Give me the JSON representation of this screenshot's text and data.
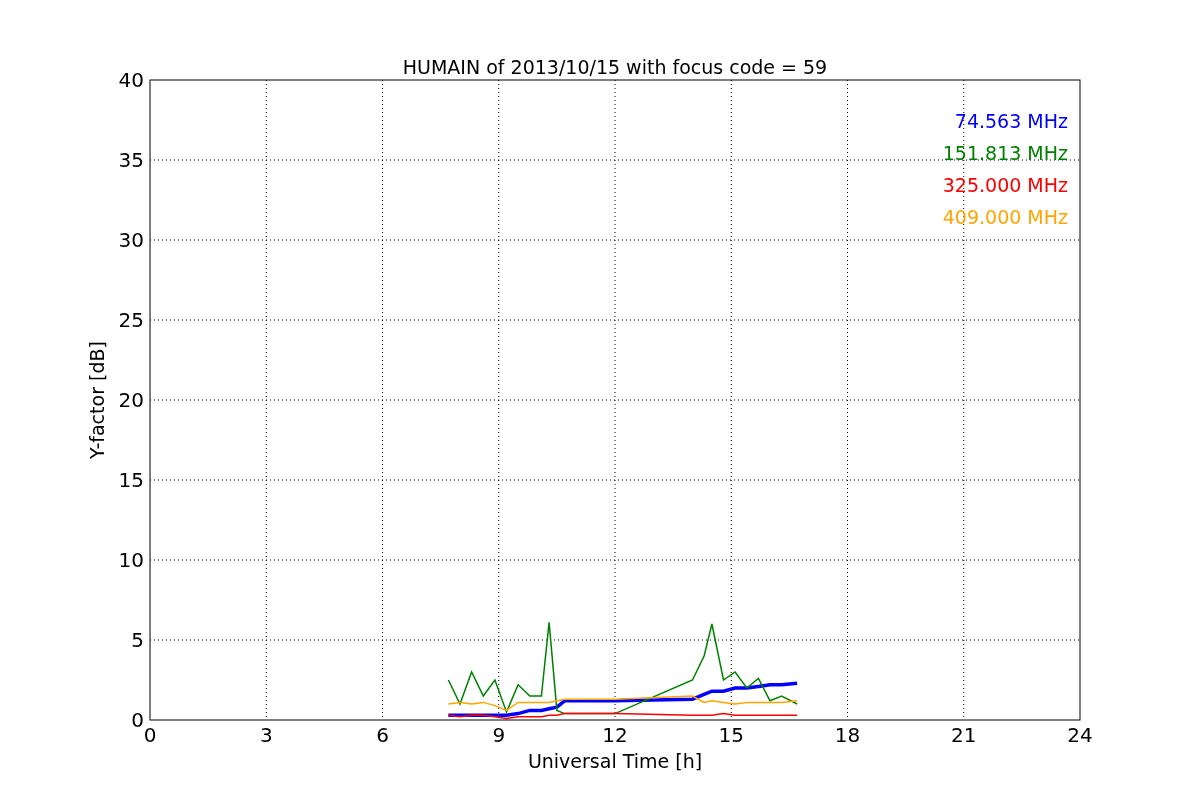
{
  "figure": {
    "chart_data": {
      "type": "line",
      "title": "HUMAIN of 2013/10/15 with focus code = 59",
      "xlabel": "Universal Time [h]",
      "ylabel": "Y-factor [dB]",
      "x": [
        7.7,
        8.0,
        8.3,
        8.6,
        8.9,
        9.2,
        9.5,
        9.8,
        10.1,
        10.3,
        10.5,
        10.7,
        12,
        14.0,
        14.3,
        14.5,
        14.8,
        15.1,
        15.4,
        15.7,
        16.0,
        16.3,
        16.7
      ],
      "series": [
        {
          "name": "74.563 MHz",
          "color": "#0000ff",
          "values": [
            0.3,
            0.3,
            0.3,
            0.3,
            0.3,
            0.3,
            0.4,
            0.6,
            0.6,
            0.7,
            0.8,
            1.2,
            1.2,
            1.3,
            1.6,
            1.8,
            1.8,
            2.0,
            2.0,
            2.1,
            2.2,
            2.2,
            2.3
          ]
        },
        {
          "name": "151.813 MHz",
          "color": "#008000",
          "values": [
            2.5,
            1.0,
            3.0,
            1.5,
            2.5,
            0.5,
            2.2,
            1.5,
            1.5,
            6.1,
            0.6,
            0.4,
            0.4,
            2.5,
            4.0,
            6.0,
            2.5,
            3.0,
            2.0,
            2.6,
            1.2,
            1.5,
            1.0
          ]
        },
        {
          "name": "325.000 MHz",
          "color": "#ff0000",
          "values": [
            0.3,
            0.2,
            0.3,
            0.3,
            0.2,
            0.1,
            0.2,
            0.2,
            0.2,
            0.3,
            0.3,
            0.4,
            0.4,
            0.3,
            0.3,
            0.3,
            0.4,
            0.3,
            0.3,
            0.3,
            0.3,
            0.3,
            0.3
          ]
        },
        {
          "name": "409.000 MHz",
          "color": "#ffa500",
          "values": [
            1.0,
            1.1,
            1.0,
            1.1,
            0.9,
            0.6,
            1.1,
            1.1,
            1.1,
            1.1,
            1.2,
            1.3,
            1.3,
            1.5,
            1.1,
            1.2,
            1.1,
            1.0,
            1.1,
            1.1,
            1.1,
            1.1,
            1.2
          ]
        }
      ],
      "xlim": [
        0,
        24
      ],
      "ylim": [
        0,
        40
      ],
      "grid": true,
      "xticks": [
        0,
        3,
        6,
        9,
        12,
        15,
        18,
        21,
        24
      ],
      "yticks": [
        0,
        5,
        10,
        15,
        20,
        25,
        30,
        35,
        40
      ]
    }
  }
}
